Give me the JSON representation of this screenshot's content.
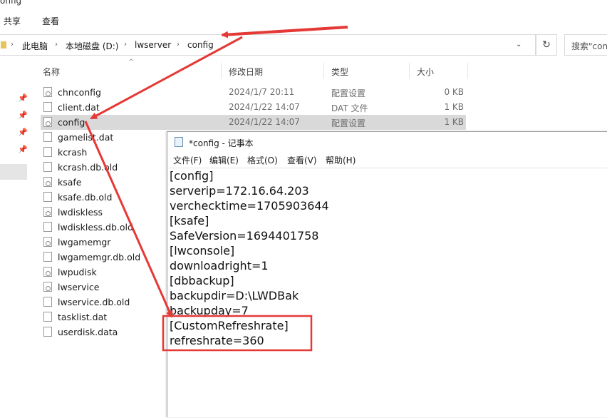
{
  "explorer": {
    "window_title": "onfig",
    "ribbon_tabs": [
      "共享",
      "查看"
    ],
    "breadcrumb": [
      "此电脑",
      "本地磁盘 (D:)",
      "lwserver",
      "config"
    ],
    "search_placeholder": "搜索\"con",
    "columns": {
      "name": "名称",
      "modified": "修改日期",
      "type": "类型",
      "size": "大小"
    },
    "files": [
      {
        "name": "chnconfig",
        "modified": "2024/1/7 20:11",
        "type": "配置设置",
        "size": "0 KB",
        "icon": "config-file-icon"
      },
      {
        "name": "client.dat",
        "modified": "2024/1/22 14:07",
        "type": "DAT 文件",
        "size": "1 KB",
        "icon": "file-icon"
      },
      {
        "name": "config",
        "modified": "2024/1/22 14:07",
        "type": "配置设置",
        "size": "1 KB",
        "icon": "config-file-icon"
      },
      {
        "name": "gamelist.dat",
        "icon": "file-icon"
      },
      {
        "name": "kcrash",
        "icon": "file-icon"
      },
      {
        "name": "kcrash.db.old",
        "icon": "file-icon"
      },
      {
        "name": "ksafe",
        "icon": "config-file-icon"
      },
      {
        "name": "ksafe.db.old",
        "icon": "file-icon"
      },
      {
        "name": "lwdiskless",
        "icon": "config-file-icon"
      },
      {
        "name": "lwdiskless.db.old",
        "icon": "file-icon"
      },
      {
        "name": "lwgamemgr",
        "icon": "config-file-icon"
      },
      {
        "name": "lwgamemgr.db.old",
        "icon": "file-icon"
      },
      {
        "name": "lwpudisk",
        "icon": "config-file-icon"
      },
      {
        "name": "lwservice",
        "icon": "config-file-icon"
      },
      {
        "name": "lwservice.db.old",
        "icon": "file-icon"
      },
      {
        "name": "tasklist.dat",
        "icon": "file-icon"
      },
      {
        "name": "userdisk.data",
        "icon": "file-icon"
      }
    ]
  },
  "notepad": {
    "title": "*config - 记事本",
    "menu": [
      "文件(F)",
      "编辑(E)",
      "格式(O)",
      "查看(V)",
      "帮助(H)"
    ],
    "lines": [
      "[config]",
      "serverip=172.16.64.203",
      "vercheck­time=1705903644",
      "[ksafe]",
      "SafeVersion=1694401758",
      "[lwconsole]",
      "downloadright=1",
      "[dbbackup]",
      "backupdir=D:\\LWDBak",
      "backupday=7",
      "[CustomRefreshrate]",
      "refreshrate=360"
    ]
  },
  "annotation_color": "#e53935"
}
